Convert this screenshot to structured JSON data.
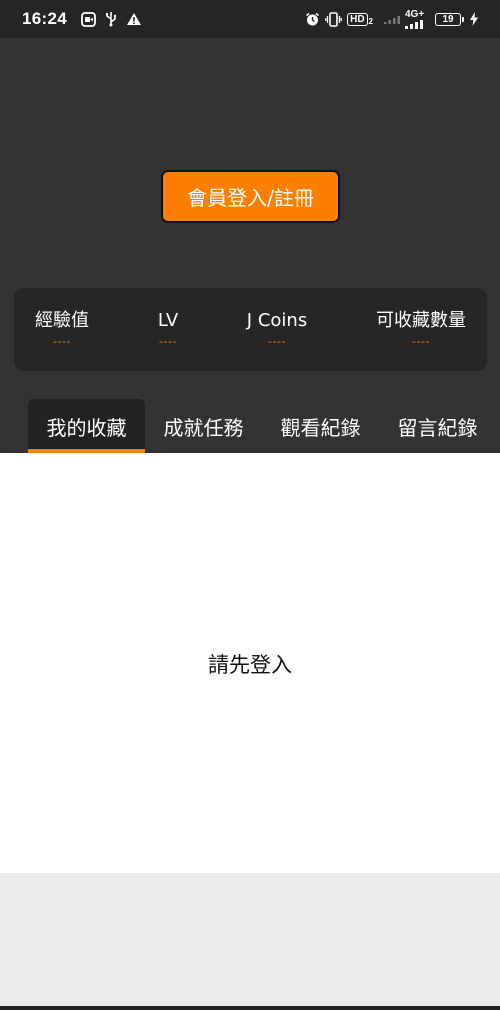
{
  "status_bar": {
    "time": "16:24",
    "left_icons": [
      "video-record-icon",
      "usb-icon",
      "warning-icon"
    ],
    "right_icons": [
      "alarm-icon",
      "vibrate-icon",
      "hd-voice-icon",
      "signal-icon",
      "battery-icon",
      "charging-icon"
    ],
    "hd_label": "HD",
    "hd_sub": "2",
    "network_label": "4G+",
    "battery_level": "19"
  },
  "header": {
    "login_button_label": "會員登入/註冊",
    "accent_color": "#fb7f00"
  },
  "stats": [
    {
      "label": "經驗值",
      "value": "----"
    },
    {
      "label": "LV",
      "value": "----"
    },
    {
      "label": "J Coins",
      "value": "----"
    },
    {
      "label": "可收藏數量",
      "value": "----"
    }
  ],
  "tabs": [
    {
      "label": "我的收藏",
      "active": true
    },
    {
      "label": "成就任務",
      "active": false
    },
    {
      "label": "觀看紀錄",
      "active": false
    },
    {
      "label": "留言紀錄",
      "active": false
    }
  ],
  "content": {
    "prompt": "請先登入"
  }
}
